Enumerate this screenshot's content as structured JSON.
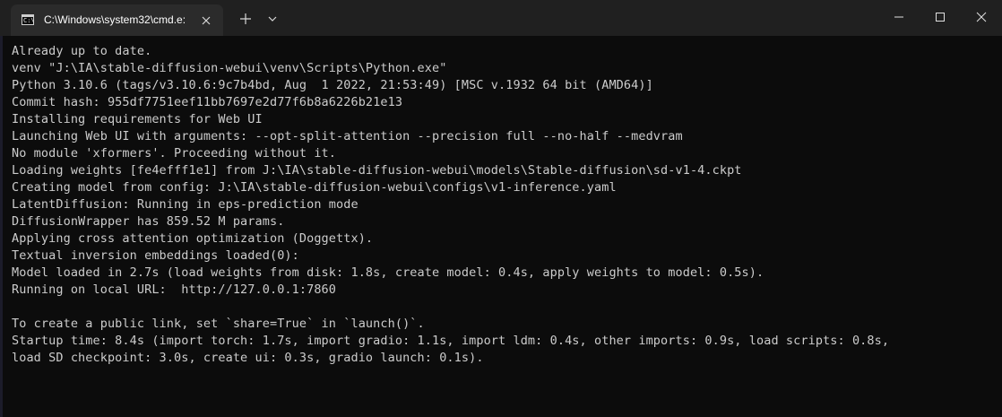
{
  "window": {
    "tab_title": "C:\\Windows\\system32\\cmd.e:",
    "tab_icon_glyph": "C:\\",
    "controls": {
      "minimize": "minimize",
      "maximize": "maximize",
      "close": "close"
    }
  },
  "terminal": {
    "lines": [
      "Already up to date.",
      "venv \"J:\\IA\\stable-diffusion-webui\\venv\\Scripts\\Python.exe\"",
      "Python 3.10.6 (tags/v3.10.6:9c7b4bd, Aug  1 2022, 21:53:49) [MSC v.1932 64 bit (AMD64)]",
      "Commit hash: 955df7751eef11bb7697e2d77f6b8a6226b21e13",
      "Installing requirements for Web UI",
      "Launching Web UI with arguments: --opt-split-attention --precision full --no-half --medvram",
      "No module 'xformers'. Proceeding without it.",
      "Loading weights [fe4efff1e1] from J:\\IA\\stable-diffusion-webui\\models\\Stable-diffusion\\sd-v1-4.ckpt",
      "Creating model from config: J:\\IA\\stable-diffusion-webui\\configs\\v1-inference.yaml",
      "LatentDiffusion: Running in eps-prediction mode",
      "DiffusionWrapper has 859.52 M params.",
      "Applying cross attention optimization (Doggettx).",
      "Textual inversion embeddings loaded(0):",
      "Model loaded in 2.7s (load weights from disk: 1.8s, create model: 0.4s, apply weights to model: 0.5s).",
      "Running on local URL:  http://127.0.0.1:7860",
      "",
      "To create a public link, set `share=True` in `launch()`.",
      "Startup time: 8.4s (import torch: 1.7s, import gradio: 1.1s, import ldm: 0.4s, other imports: 0.9s, load scripts: 0.8s,",
      "load SD checkpoint: 3.0s, create ui: 0.3s, gradio launch: 0.1s)."
    ]
  },
  "colors": {
    "background": "#0c0c0c",
    "titlebar": "#202020",
    "active_tab": "#2b2b2b",
    "text": "#cccccc"
  }
}
